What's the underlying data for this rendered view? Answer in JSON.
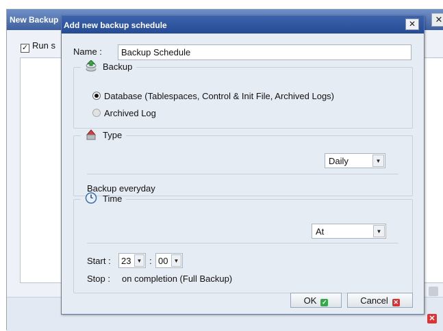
{
  "background_window": {
    "title": "New Backup",
    "close_glyph": "✕",
    "run_label": "Run s",
    "run_checked": true,
    "run_check_glyph": "✓"
  },
  "dialog": {
    "title": "Add new backup schedule",
    "close_glyph": "✕",
    "name_label": "Name :",
    "name_value": "Backup Schedule",
    "backup": {
      "legend": "Backup",
      "icon": "backup-icon",
      "options": [
        {
          "label": "Database (Tablespaces, Control & Init File, Archived Logs)",
          "selected": true
        },
        {
          "label": "Archived Log",
          "selected": false
        }
      ]
    },
    "type": {
      "legend": "Type",
      "icon": "type-icon",
      "selected": "Daily",
      "description": "Backup everyday"
    },
    "time": {
      "legend": "Time",
      "icon": "clock-icon",
      "mode": "At",
      "start_label": "Start :",
      "start_hour": "23",
      "separator": ":",
      "start_minute": "00",
      "stop_label": "Stop :",
      "stop_value": "on completion (Full Backup)"
    },
    "ok_label": "OK",
    "cancel_label": "Cancel",
    "ok_icon_glyph": "✓",
    "cancel_icon_glyph": "✕",
    "dropdown_arrow": "▼"
  },
  "colors": {
    "titlebar": "#2f55a0",
    "dialog_bg": "#e6ecf4",
    "ok_green": "#3aa64a",
    "cancel_red": "#d93030"
  }
}
